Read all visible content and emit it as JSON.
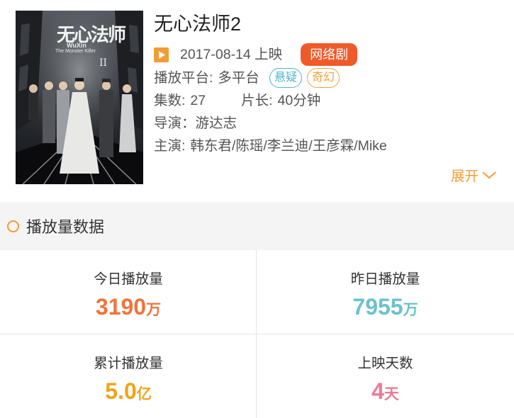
{
  "show": {
    "title": "无心法师2",
    "release_date": "2017-08-14 上映",
    "type_badge": "网络剧",
    "platform_label": "播放平台:",
    "platform_value": "多平台",
    "genres": [
      "悬疑",
      "奇幻"
    ],
    "episodes_label": "集数:",
    "episodes_value": "27",
    "duration_label": "片长:",
    "duration_value": "40分钟",
    "director_label": "导演：",
    "director_value": "游达志",
    "cast_label": "主演:",
    "cast_value": "韩东君/陈瑶/李兰迪/王彦霖/Mike",
    "expand_label": "展开",
    "poster_title": "无心法师",
    "poster_subtitle_en": "WuXin",
    "poster_subtitle_en2": "The Monster Killer",
    "poster_numeral": "II"
  },
  "section": {
    "title": "播放量数据"
  },
  "stats": [
    {
      "label": "今日播放量",
      "value": "3190",
      "unit": "万",
      "color": "#f0743a"
    },
    {
      "label": "昨日播放量",
      "value": "7955",
      "unit": "万",
      "color": "#6cc2cc"
    },
    {
      "label": "累计播放量",
      "value": "5.0",
      "unit": "亿",
      "color": "#f2a318"
    },
    {
      "label": "上映天数",
      "value": "4",
      "unit": "天",
      "color": "#ec7b97"
    }
  ],
  "colors": {
    "accent_orange": "#f39c33",
    "badge_red": "#f05a2a",
    "tag_blue": "#4fb6cc",
    "tag_orange": "#f2a13a"
  }
}
